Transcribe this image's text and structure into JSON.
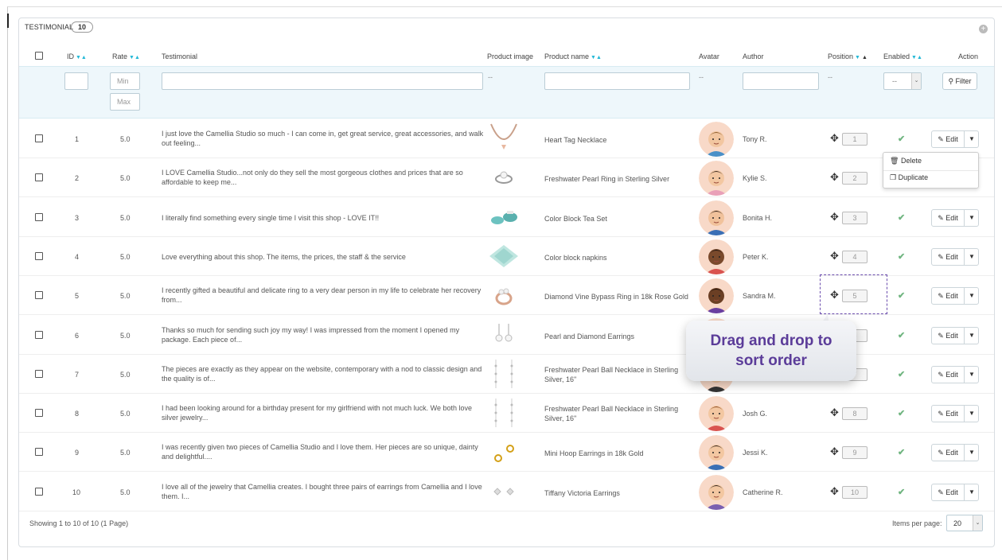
{
  "panel": {
    "title": "TESTIMONIAL",
    "count": "10"
  },
  "columns": {
    "id": "ID",
    "rate": "Rate",
    "testimonial": "Testimonial",
    "product_image": "Product image",
    "product_name": "Product name",
    "avatar": "Avatar",
    "author": "Author",
    "position": "Position",
    "enabled": "Enabled",
    "action": "Action"
  },
  "filters": {
    "min_placeholder": "Min",
    "max_placeholder": "Max",
    "dash": "--",
    "enabled_value": "--",
    "filter_label": "Filter"
  },
  "rows": [
    {
      "id": "1",
      "rate": "5.0",
      "text": "I just love the Camellia Studio so much - I can come in, get great service, great accessories, and walk out feeling...",
      "product": "Heart Tag Necklace",
      "author": "Tony R.",
      "position": "1",
      "image": "necklace",
      "avatar_skin": "#f2c6a0",
      "avatar_hair": "#8a5a2b",
      "avatar_shirt": "#4a90c8"
    },
    {
      "id": "2",
      "rate": "5.0",
      "text": "I LOVE Camellia Studio...not only do they sell the most gorgeous clothes and prices that are so affordable to keep me...",
      "product": "Freshwater Pearl Ring in Sterling Silver",
      "author": "Kylie S.",
      "position": "2",
      "image": "ring",
      "avatar_skin": "#f3c7a1",
      "avatar_hair": "#3b2a20",
      "avatar_shirt": "#e9a0b8"
    },
    {
      "id": "3",
      "rate": "5.0",
      "text": "I literally find something every single time I visit this shop - LOVE IT!!",
      "product": "Color Block Tea Set",
      "author": "Bonita H.",
      "position": "3",
      "image": "teaset",
      "avatar_skin": "#f1c29b",
      "avatar_hair": "#2b1d17",
      "avatar_shirt": "#3a6fb5"
    },
    {
      "id": "4",
      "rate": "5.0",
      "text": "Love everything about this shop. The items, the prices, the staff & the service",
      "product": "Color block napkins",
      "author": "Peter K.",
      "position": "4",
      "image": "napkins",
      "avatar_skin": "#7a4a2c",
      "avatar_hair": "#1e1410",
      "avatar_shirt": "#d9534f"
    },
    {
      "id": "5",
      "rate": "5.0",
      "text": "I recently gifted a beautiful and delicate ring to a very dear person in my life to celebrate her recovery from...",
      "product": "Diamond Vine Bypass Ring in 18k Rose Gold",
      "author": "Sandra M.",
      "position": "5",
      "image": "rosering",
      "avatar_skin": "#6b3f24",
      "avatar_hair": "#1c120c",
      "avatar_shirt": "#6a3fa0"
    },
    {
      "id": "6",
      "rate": "5.0",
      "text": "Thanks so much for sending such joy my way! I was impressed from the moment I opened my package. Each piece of...",
      "product": "Pearl and Diamond Earrings",
      "author": "",
      "position": "6",
      "image": "earrings",
      "avatar_skin": "#f2c6a0",
      "avatar_hair": "#8a5a2b",
      "avatar_shirt": "#4a90c8"
    },
    {
      "id": "7",
      "rate": "5.0",
      "text": "The pieces are exactly as they appear on the website, contemporary with a nod to classic design and the quality is of...",
      "product": "Freshwater Pearl Ball Necklace in Sterling Silver, 16\"",
      "author": "",
      "position": "7",
      "image": "pearlnecklace",
      "avatar_skin": "#f2c6a0",
      "avatar_hair": "#2b1d17",
      "avatar_shirt": "#333"
    },
    {
      "id": "8",
      "rate": "5.0",
      "text": "I had been looking around for a birthday present for my girlfriend with not much luck. We both love silver jewelry...",
      "product": "Freshwater Pearl Ball Necklace in Sterling Silver, 16\"",
      "author": "Josh G.",
      "position": "8",
      "image": "pearlnecklace",
      "avatar_skin": "#f3c7a1",
      "avatar_hair": "#8a4a22",
      "avatar_shirt": "#d9534f"
    },
    {
      "id": "9",
      "rate": "5.0",
      "text": "I was recently given two pieces of Camellia Studio and I love them. Her pieces are so unique, dainty and delightful....",
      "product": "Mini Hoop Earrings in 18k Gold",
      "author": "Jessi K.",
      "position": "9",
      "image": "hoops",
      "avatar_skin": "#f3c7a1",
      "avatar_hair": "#2b1d17",
      "avatar_shirt": "#3a6fb5"
    },
    {
      "id": "10",
      "rate": "5.0",
      "text": "I love all of the jewelry that Camellia creates. I bought three pairs of earrings from Camellia and I love them. I...",
      "product": "Tiffany Victoria Earrings",
      "author": "Catherine R.",
      "position": "10",
      "image": "victoria",
      "avatar_skin": "#f3c7a1",
      "avatar_hair": "#2b1d17",
      "avatar_shirt": "#7a5fb0"
    }
  ],
  "row_actions": {
    "edit_label": "Edit",
    "delete_label": "Delete",
    "duplicate_label": "Duplicate"
  },
  "tooltip": {
    "line1": "Drag and drop to",
    "line2": "sort order"
  },
  "footer": {
    "showing": "Showing 1 to 10 of 10 (1 Page)",
    "items_per_page_label": "Items per page:",
    "items_per_page_value": "20"
  },
  "colors": {
    "accent": "#25b9d7",
    "enabled_check": "#70b580",
    "tooltip_text": "#5b3c99",
    "filter_row_bg": "#eef7fb"
  }
}
